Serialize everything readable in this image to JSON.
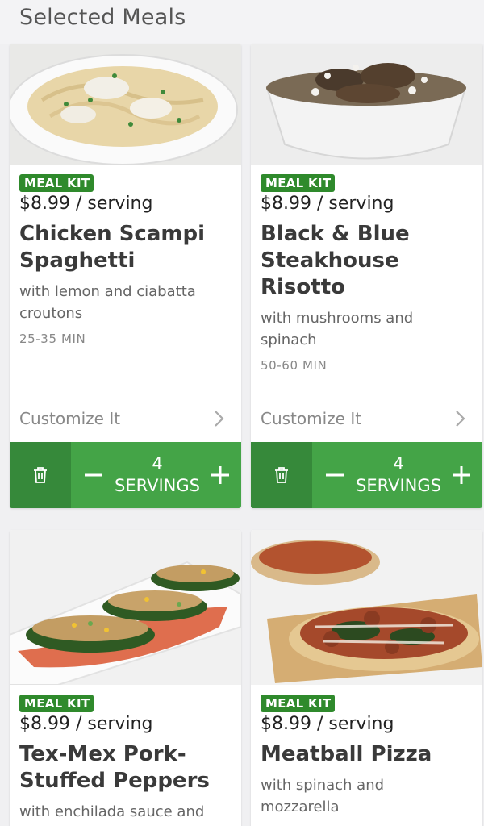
{
  "header": {
    "title": "Selected Meals"
  },
  "meals": [
    {
      "badge": "MEAL KIT",
      "price": "$8.99 / serving",
      "name_line1": "Chicken Scampi",
      "name_line2": "Spaghetti",
      "sub_line1": "with lemon and ciabatta",
      "sub_line2": "croutons",
      "time": "25-35 MIN",
      "customize": "Customize It",
      "servings_count": "4",
      "servings_label": "SERVINGS"
    },
    {
      "badge": "MEAL KIT",
      "price": "$8.99 / serving",
      "name_line1": "Black & Blue",
      "name_line2": "Steakhouse",
      "name_line3": "Risotto",
      "sub_line1": "with mushrooms and",
      "sub_line2": "spinach",
      "time": "50-60 MIN",
      "customize": "Customize It",
      "servings_count": "4",
      "servings_label": "SERVINGS"
    },
    {
      "badge": "MEAL KIT",
      "price": "$8.99 / serving",
      "name_line1": "Tex-Mex Pork-",
      "name_line2": "Stuffed Peppers",
      "sub_line1": "with enchilada sauce and"
    },
    {
      "badge": "MEAL KIT",
      "price": "$8.99 / serving",
      "name_line1": "Meatball Pizza",
      "sub_line1": "with spinach and",
      "sub_line2": "mozzarella"
    }
  ],
  "icons": {
    "trash": "trash-icon",
    "minus": "minus-icon",
    "plus": "plus-icon",
    "chevron": "chevron-right-icon"
  },
  "colors": {
    "badge": "#2f8a2c",
    "stepper": "#44a447",
    "stepper_dark": "#36893a"
  }
}
